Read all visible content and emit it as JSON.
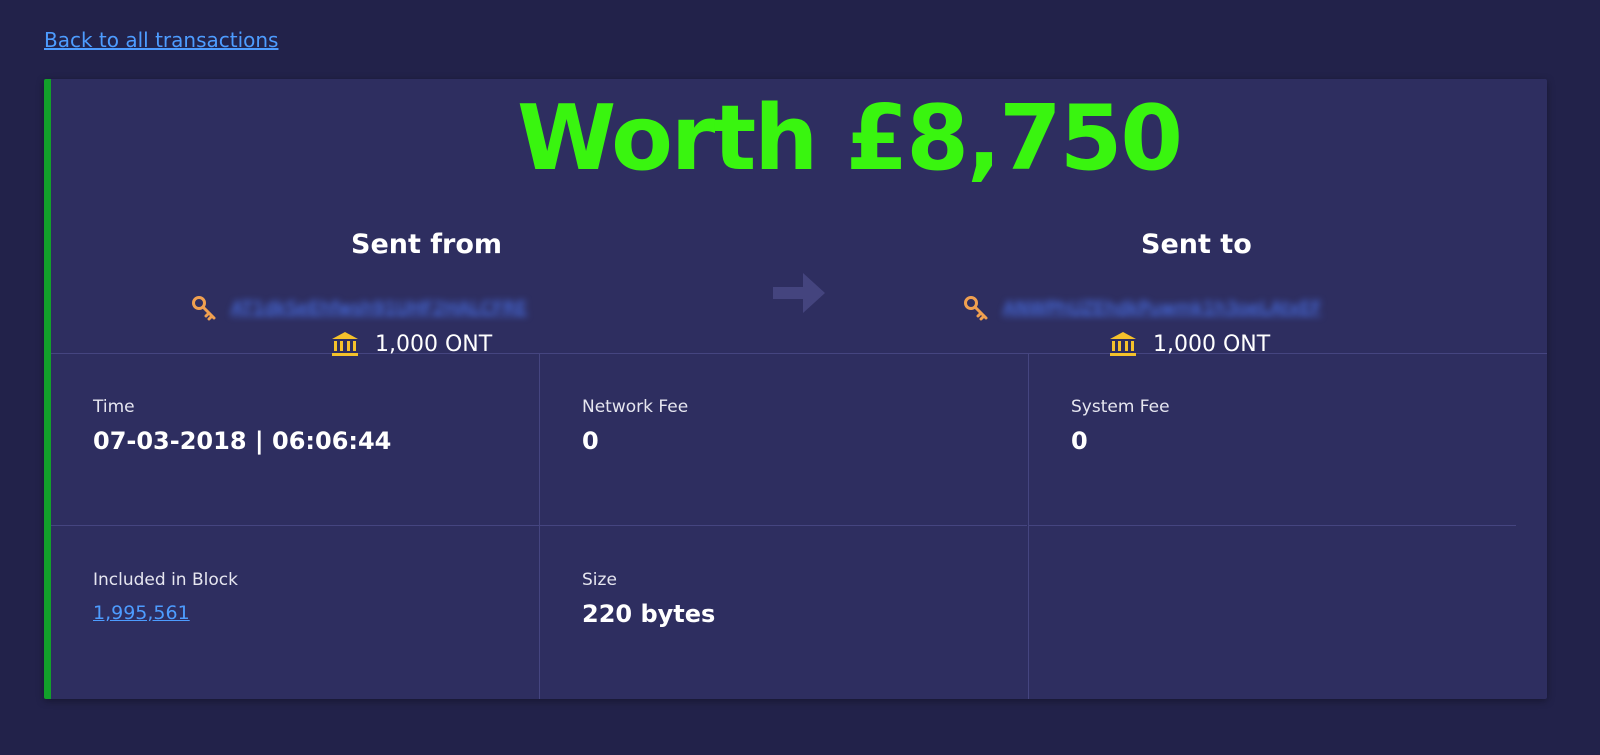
{
  "nav": {
    "back_label": "Back to all transactions"
  },
  "overlay": {
    "worth_text": "Worth £8,750",
    "color": "#39f50f"
  },
  "transfer": {
    "from_heading": "Sent from",
    "to_heading": "Sent to",
    "from_address": "AT1dkSeEhfwsh91UHF2HALCFRE",
    "to_address": "ANWPhUZEhdkPuwmk1h3oeLAtxEF",
    "from_balance": "1,000 ONT",
    "to_balance": "1,000 ONT",
    "arrow_icon": "arrow-right-icon",
    "address_icon": "key-icon",
    "balance_icon": "bank-icon"
  },
  "details": {
    "time_label": "Time",
    "time_value": "07-03-2018 | 06:06:44",
    "network_fee_label": "Network Fee",
    "network_fee_value": "0",
    "system_fee_label": "System Fee",
    "system_fee_value": "0",
    "block_label": "Included in Block",
    "block_value": "1,995,561",
    "size_label": "Size",
    "size_value": "220 bytes"
  },
  "colors": {
    "page_bg": "#22224a",
    "card_bg": "#2e2e60",
    "accent_bar": "#12a02a",
    "link": "#4d9cff"
  }
}
